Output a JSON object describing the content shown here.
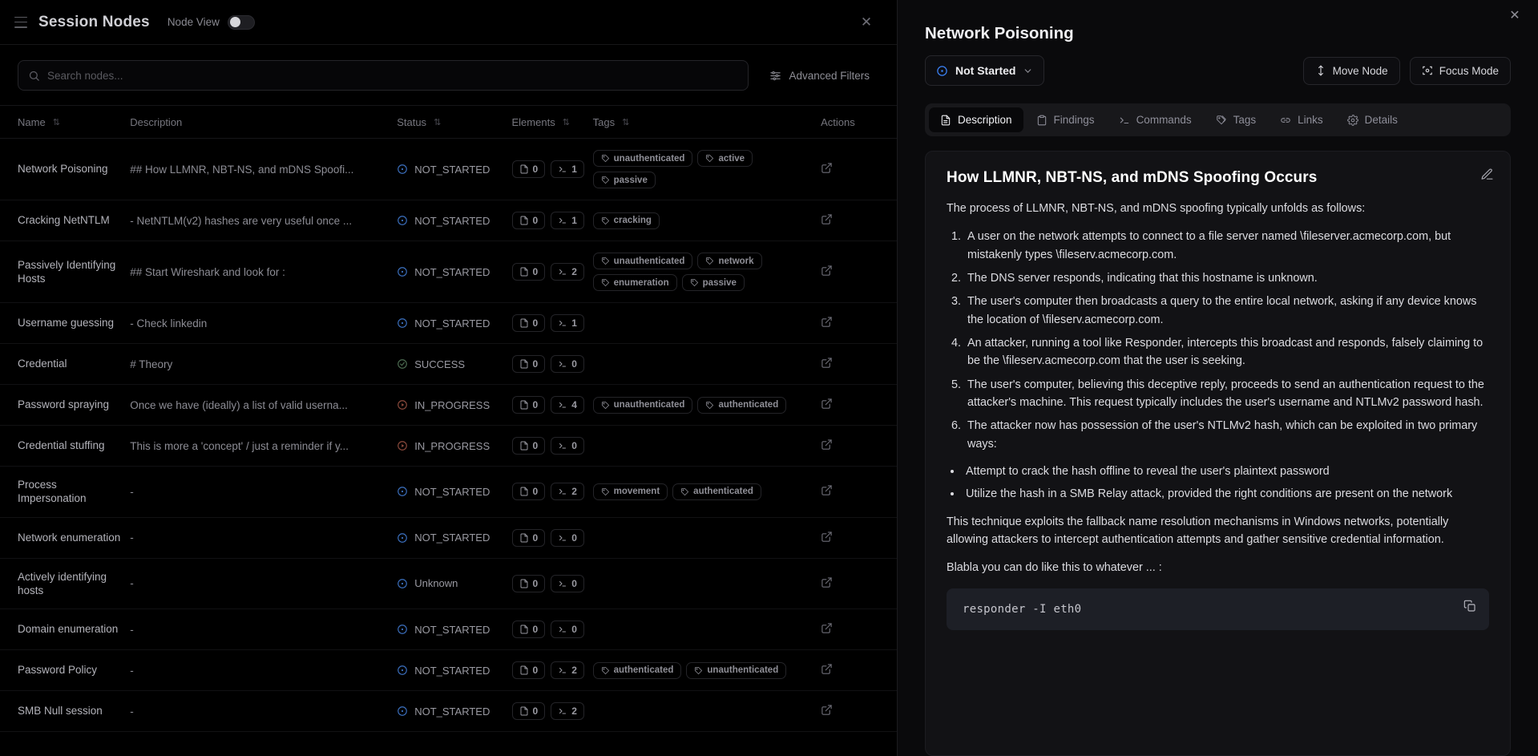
{
  "left_panel": {
    "title": "Session Nodes",
    "node_view_label": "Node View",
    "node_view_on": false,
    "close_label": "✕",
    "search": {
      "placeholder": "Search nodes...",
      "value": ""
    },
    "advanced_filters_label": "Advanced Filters",
    "columns": [
      {
        "key": "name",
        "label": "Name",
        "sortable": true
      },
      {
        "key": "description",
        "label": "Description",
        "sortable": false
      },
      {
        "key": "status",
        "label": "Status",
        "sortable": true
      },
      {
        "key": "elements",
        "label": "Elements",
        "sortable": true
      },
      {
        "key": "tags",
        "label": "Tags",
        "sortable": true
      },
      {
        "key": "actions",
        "label": "Actions",
        "sortable": false
      }
    ],
    "rows": [
      {
        "name": "Network Poisoning",
        "description": "## How LLMNR, NBT-NS, and mDNS Spoofi...",
        "status": "NOT_STARTED",
        "status_kind": "not-started",
        "docs": "0",
        "cmds": "1",
        "tags": [
          "unauthenticated",
          "active",
          "passive"
        ]
      },
      {
        "name": "Cracking NetNTLM",
        "description": "- NetNTLM(v2) hashes are very useful once ...",
        "status": "NOT_STARTED",
        "status_kind": "not-started",
        "docs": "0",
        "cmds": "1",
        "tags": [
          "cracking"
        ]
      },
      {
        "name": "Passively Identifying Hosts",
        "description": "## Start Wireshark and look for :",
        "status": "NOT_STARTED",
        "status_kind": "not-started",
        "docs": "0",
        "cmds": "2",
        "tags": [
          "unauthenticated",
          "network",
          "enumeration",
          "passive"
        ]
      },
      {
        "name": "Username guessing",
        "description": "- Check linkedin",
        "status": "NOT_STARTED",
        "status_kind": "not-started",
        "docs": "0",
        "cmds": "1",
        "tags": []
      },
      {
        "name": "Credential",
        "description": "# Theory",
        "status": "SUCCESS",
        "status_kind": "success",
        "docs": "0",
        "cmds": "0",
        "tags": []
      },
      {
        "name": "Password spraying",
        "description": "Once we have (ideally) a list of valid userna...",
        "status": "IN_PROGRESS",
        "status_kind": "in-progress",
        "docs": "0",
        "cmds": "4",
        "tags": [
          "unauthenticated",
          "authenticated"
        ]
      },
      {
        "name": "Credential stuffing",
        "description": "This is more a 'concept' / just a reminder if y...",
        "status": "IN_PROGRESS",
        "status_kind": "in-progress",
        "docs": "0",
        "cmds": "0",
        "tags": []
      },
      {
        "name": "Process Impersonation",
        "description": "-",
        "status": "NOT_STARTED",
        "status_kind": "not-started",
        "docs": "0",
        "cmds": "2",
        "tags": [
          "movement",
          "authenticated"
        ]
      },
      {
        "name": "Network enumeration",
        "description": "-",
        "status": "NOT_STARTED",
        "status_kind": "not-started",
        "docs": "0",
        "cmds": "0",
        "tags": []
      },
      {
        "name": "Actively identifying hosts",
        "description": "-",
        "status": "Unknown",
        "status_kind": "unknown",
        "docs": "0",
        "cmds": "0",
        "tags": []
      },
      {
        "name": "Domain enumeration",
        "description": "-",
        "status": "NOT_STARTED",
        "status_kind": "not-started",
        "docs": "0",
        "cmds": "0",
        "tags": []
      },
      {
        "name": "Password Policy",
        "description": "-",
        "status": "NOT_STARTED",
        "status_kind": "not-started",
        "docs": "0",
        "cmds": "2",
        "tags": [
          "authenticated",
          "unauthenticated"
        ]
      },
      {
        "name": "SMB Null session",
        "description": "-",
        "status": "NOT_STARTED",
        "status_kind": "not-started",
        "docs": "0",
        "cmds": "2",
        "tags": []
      }
    ]
  },
  "right_panel": {
    "close_label": "✕",
    "node_title": "Network Poisoning",
    "status": {
      "label": "Not Started",
      "accent": "#3b82f6"
    },
    "buttons": [
      {
        "key": "move-node",
        "label": "Move Node"
      },
      {
        "key": "focus-mode",
        "label": "Focus Mode"
      }
    ],
    "tabs": [
      {
        "key": "description",
        "label": "Description",
        "active": true
      },
      {
        "key": "findings",
        "label": "Findings",
        "active": false
      },
      {
        "key": "commands",
        "label": "Commands",
        "active": false
      },
      {
        "key": "tags",
        "label": "Tags",
        "active": false
      },
      {
        "key": "links",
        "label": "Links",
        "active": false
      },
      {
        "key": "details",
        "label": "Details",
        "active": false
      }
    ],
    "description": {
      "heading": "How LLMNR, NBT-NS, and mDNS Spoofing Occurs",
      "intro": "The process of LLMNR, NBT-NS, and mDNS spoofing typically unfolds as follows:",
      "steps": [
        "A user on the network attempts to connect to a file server named \\fileserver.acmecorp.com, but mistakenly types \\fileserv.acmecorp.com.",
        "The DNS server responds, indicating that this hostname is unknown.",
        "The user's computer then broadcasts a query to the entire local network, asking if any device knows the location of \\fileserv.acmecorp.com.",
        "An attacker, running a tool like Responder, intercepts this broadcast and responds, falsely claiming to be the \\fileserv.acmecorp.com that the user is seeking.",
        "The user's computer, believing this deceptive reply, proceeds to send an authentication request to the attacker's machine. This request typically includes the user's username and NTLMv2 password hash.",
        "The attacker now has possession of the user's NTLMv2 hash, which can be exploited in two primary ways:"
      ],
      "sub_bullets": [
        "Attempt to crack the hash offline to reveal the user's plaintext password",
        "Utilize the hash in a SMB Relay attack, provided the right conditions are present on the network"
      ],
      "closing": "This technique exploits the fallback name resolution mechanisms in Windows networks, potentially allowing attackers to intercept authentication attempts and gather sensitive credential information.",
      "code_intro": "Blabla you can do like this to whatever ... :",
      "code": "responder -I eth0"
    }
  }
}
